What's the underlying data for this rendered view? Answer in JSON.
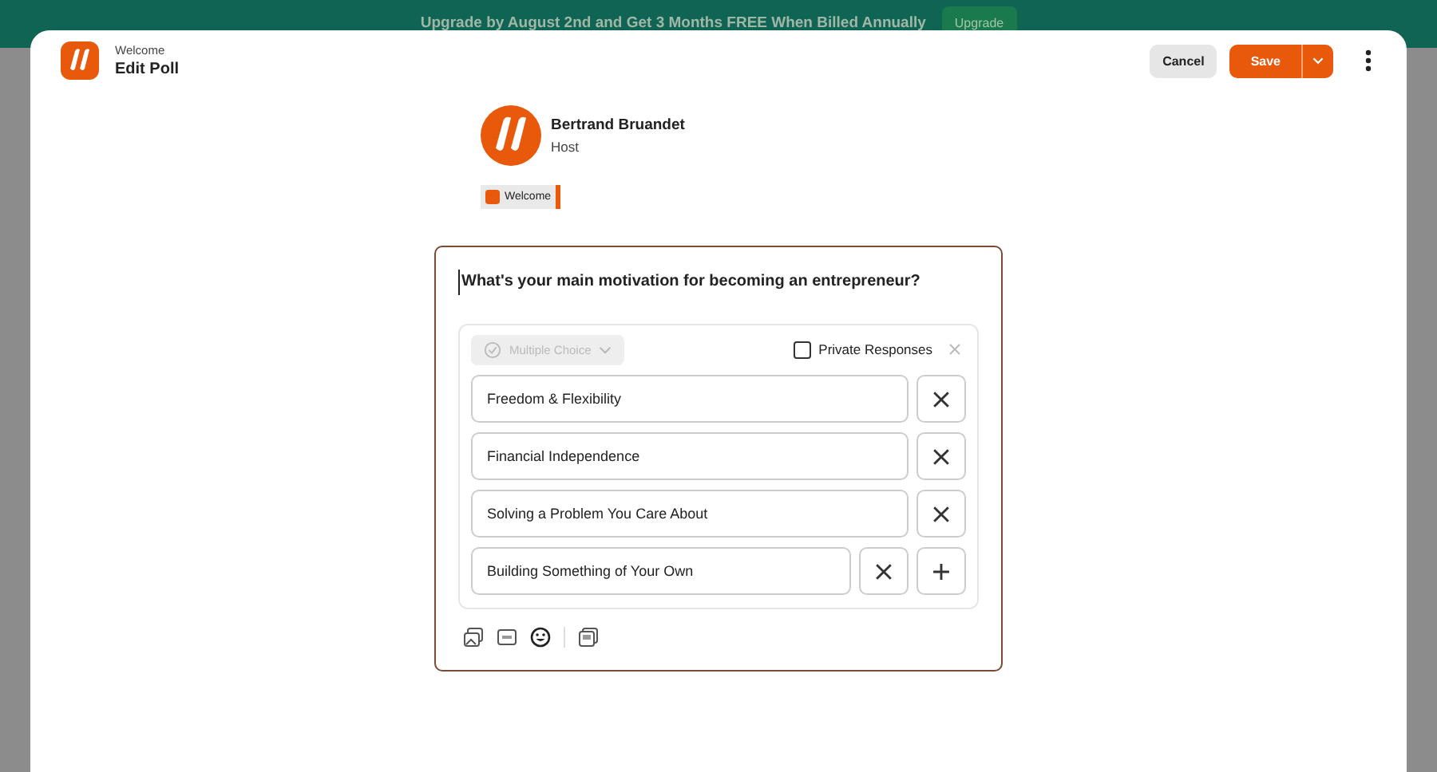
{
  "banner": {
    "text": "Upgrade by August 2nd and Get 3 Months FREE When Billed Annually",
    "button": "Upgrade"
  },
  "header": {
    "subtitle": "Welcome",
    "title": "Edit Poll",
    "cancel": "Cancel",
    "save": "Save"
  },
  "host": {
    "name": "Bertrand Bruandet",
    "role": "Host",
    "tag": "Welcome"
  },
  "poll": {
    "question": "What's your main motivation for becoming an entrepreneur?",
    "type_select": {
      "value": "Multiple Choice",
      "disabled": true
    },
    "private_responses": {
      "label": "Private Responses",
      "checked": false
    },
    "options": [
      {
        "text": "Freedom & Flexibility"
      },
      {
        "text": "Financial Independence"
      },
      {
        "text": "Solving a Problem You Care About"
      },
      {
        "text": "Building Something of Your Own"
      }
    ]
  }
}
